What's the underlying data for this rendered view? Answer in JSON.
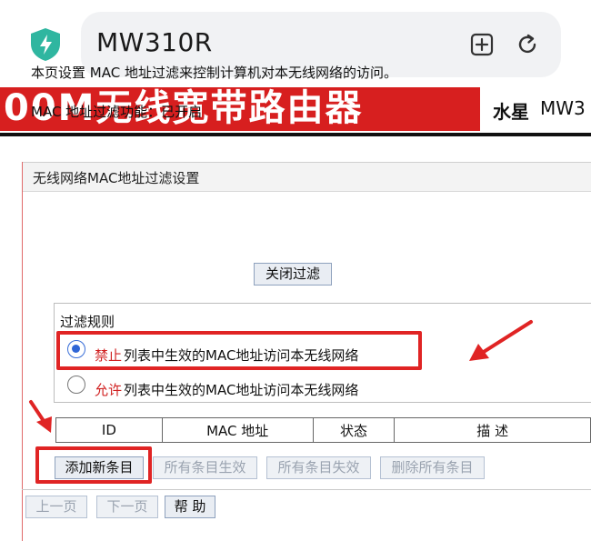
{
  "browser": {
    "url": "MW310R",
    "icons": [
      "shield-icon",
      "bookmark-add-icon",
      "reload-icon"
    ]
  },
  "banner": {
    "title": "00M无线宽带路由器",
    "brand": "水星",
    "model": "MW3"
  },
  "panel": {
    "title": "无线网络MAC地址过滤设置",
    "description": "本页设置 MAC 地址过滤来控制计算机对本无线网络的访问。",
    "status_label": "MAC 地址过滤功能：已开启",
    "close_filter_button": "关闭过滤",
    "rules": {
      "legend": "过滤规则",
      "deny_key": "禁止",
      "deny_rest": " 列表中生效的MAC地址访问本无线网络",
      "deny_selected": true,
      "allow_key": "允许",
      "allow_rest": " 列表中生效的MAC地址访问本无线网络",
      "allow_selected": false
    },
    "table_headers": [
      "ID",
      "MAC 地址",
      "状态",
      "描 述"
    ],
    "actions": {
      "add": "添加新条目",
      "enable_all": "所有条目生效",
      "disable_all": "所有条目失效",
      "delete_all": "删除所有条目"
    },
    "pager": {
      "prev": "上一页",
      "next": "下一页",
      "help": "帮 助"
    }
  },
  "colors": {
    "banner_red": "#d71f1f",
    "highlight_red": "#e02424",
    "accent_key_red": "#d02020",
    "radio_blue": "#2f66d6"
  }
}
